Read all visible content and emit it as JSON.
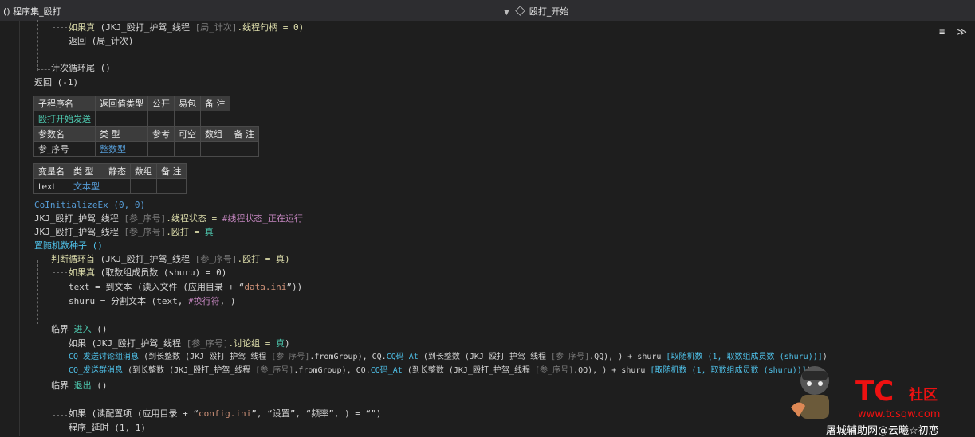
{
  "topbar": {
    "left_icon": "()",
    "left_label": "程序集_殴打",
    "mid_label": "殴打_开始"
  },
  "right_icons": "≡ ≫",
  "lines": {
    "l1_kw": "如果真",
    "l1_a": "(JKJ_殴打_护驾_线程",
    "l1_b": "[局_计次]",
    "l1_c": ".线程句柄 = 0)",
    "l2": "返回 (局_计次)",
    "l3": "计次循环尾 ()",
    "l4": "返回 (-1)",
    "sub_tbl": {
      "h": [
        "子程序名",
        "返回值类型",
        "公开",
        "易包",
        "备 注"
      ],
      "r": [
        "殴打开始发送",
        "",
        "",
        "",
        ""
      ]
    },
    "param_tbl": {
      "h": [
        "参数名",
        "类 型",
        "参考",
        "可空",
        "数组",
        "备 注"
      ],
      "r": [
        "参_序号",
        "整数型",
        "",
        "",
        "",
        ""
      ]
    },
    "var_tbl": {
      "h": [
        "变量名",
        "类 型",
        "静态",
        "数组",
        "备 注"
      ],
      "r": [
        "text",
        "文本型",
        "",
        "",
        ""
      ]
    },
    "c1": "CoInitializeEx (0, 0)",
    "c2a": "JKJ_殴打_护驾_线程",
    "c2b": "[参_序号]",
    "c2c": ".线程状态 = ",
    "c2d": "#线程状态_正在运行",
    "c3a": "JKJ_殴打_护驾_线程",
    "c3b": "[参_序号]",
    "c3c": ".殴打 = ",
    "c3d": "真",
    "c4": "置随机数种子 ()",
    "c5a": "判断循环首",
    "c5b": "(JKJ_殴打_护驾_线程",
    "c5c": "[参_序号]",
    "c5d": ".殴打 = 真)",
    "c6a": "如果真",
    "c6b": "(取数组成员数 (shuru) = 0)",
    "c7a": "text = 到文本 (读入文件 (应用目录 + “",
    "c7b": "data.ini",
    "c7c": "”))",
    "c8a": "shuru = 分割文本 (text, ",
    "c8b": "#换行符",
    "c8c": ", )",
    "c9a": "临界 ",
    "c9b": "进入",
    "c9c": " ()",
    "c10a": "如果 (JKJ_殴打_护驾_线程 ",
    "c10b": "[参_序号]",
    "c10c": ".讨论组 = ",
    "c10d": "真",
    "c10e": ")",
    "c11a": "CQ_发送讨论组消息",
    "c11b": " (到长整数 (JKJ_殴打_护驾_线程 ",
    "c11c": "[参_序号]",
    "c11d": ".fromGroup), CQ.",
    "c11e": "CQ码_At",
    "c11f": " (到长整数 (JKJ_殴打_护驾_线程 ",
    "c11g": "[参_序号]",
    "c11h": ".QQ), ) + shuru ",
    "c11i": "[取随机数 (1, 取数组成员数 (shuru))]",
    "c11j": ")",
    "c12a": "CQ_发送群消息",
    "c12b": " (到长整数 (JKJ_殴打_护驾_线程 ",
    "c12c": "[参_序号]",
    "c12d": ".fromGroup), CQ.",
    "c12e": "CQ码_At",
    "c12f": " (到长整数 (JKJ_殴打_护驾_线程 ",
    "c12g": "[参_序号]",
    "c12h": ".QQ), ) + shuru ",
    "c12i": "[取随机数 (1, 取数组成员数 (shuru))]",
    "c12j": ")",
    "c13a": "临界 ",
    "c13b": "退出",
    "c13c": " ()",
    "c14a": "如果 (读配置项 (应用目录 + “",
    "c14b": "config.ini",
    "c14c": "”, “设置”, “频率”, ) = “”)",
    "c15": "程序_延时 (1, 1)"
  },
  "watermark": {
    "tc": "TC",
    "community": "社区",
    "url": "www.tcsqw.com",
    "signature": "屠城辅助网@云曦☆初恋"
  }
}
